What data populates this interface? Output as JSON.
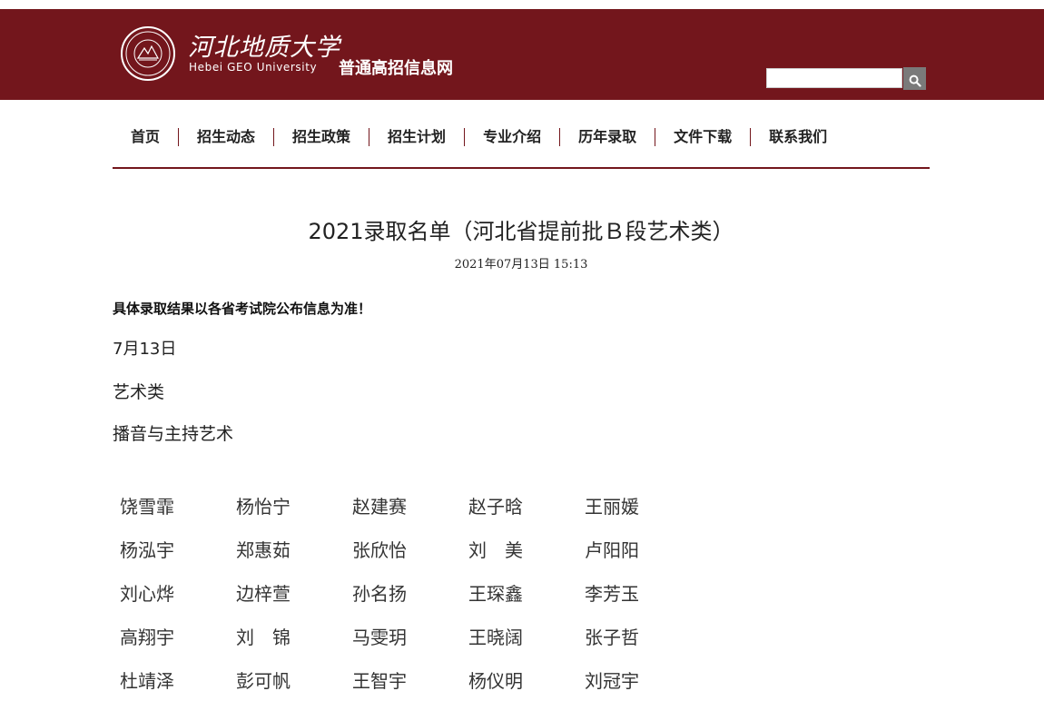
{
  "header": {
    "logo_cn": "河北地质大学",
    "logo_en": "Hebei GEO University",
    "seal_text": "Hebei GEO University",
    "seal_year": "1953",
    "site_name": "普通高招信息网",
    "search_placeholder": "",
    "search_icon": "search-icon",
    "brand_color": "#73161c"
  },
  "nav": {
    "items": [
      {
        "label": "首页"
      },
      {
        "label": "招生动态"
      },
      {
        "label": "招生政策"
      },
      {
        "label": "招生计划"
      },
      {
        "label": "专业介绍"
      },
      {
        "label": "历年录取"
      },
      {
        "label": "文件下载"
      },
      {
        "label": "联系我们"
      }
    ]
  },
  "article": {
    "title": "2021录取名单（河北省提前批Ｂ段艺术类）",
    "date": "2021年07月13日 15:13",
    "notice": "具体录取结果以各省考试院公布信息为准！",
    "date_heading": "7月13日",
    "category": "艺术类",
    "major": "播音与主持艺术",
    "names": [
      [
        "饶雪霏",
        "杨怡宁",
        "赵建赛",
        "赵子晗",
        "王丽媛"
      ],
      [
        "杨泓宇",
        "郑惠茹",
        "张欣怡",
        "刘　美",
        "卢阳阳"
      ],
      [
        "刘心烨",
        "边梓萱",
        "孙名扬",
        "王琛鑫",
        "李芳玉"
      ],
      [
        "高翔宇",
        "刘　锦",
        "马雯玥",
        "王晓阔",
        "张子哲"
      ],
      [
        "杜靖泽",
        "彭可帆",
        "王智宇",
        "杨仪明",
        "刘冠宇"
      ]
    ]
  }
}
